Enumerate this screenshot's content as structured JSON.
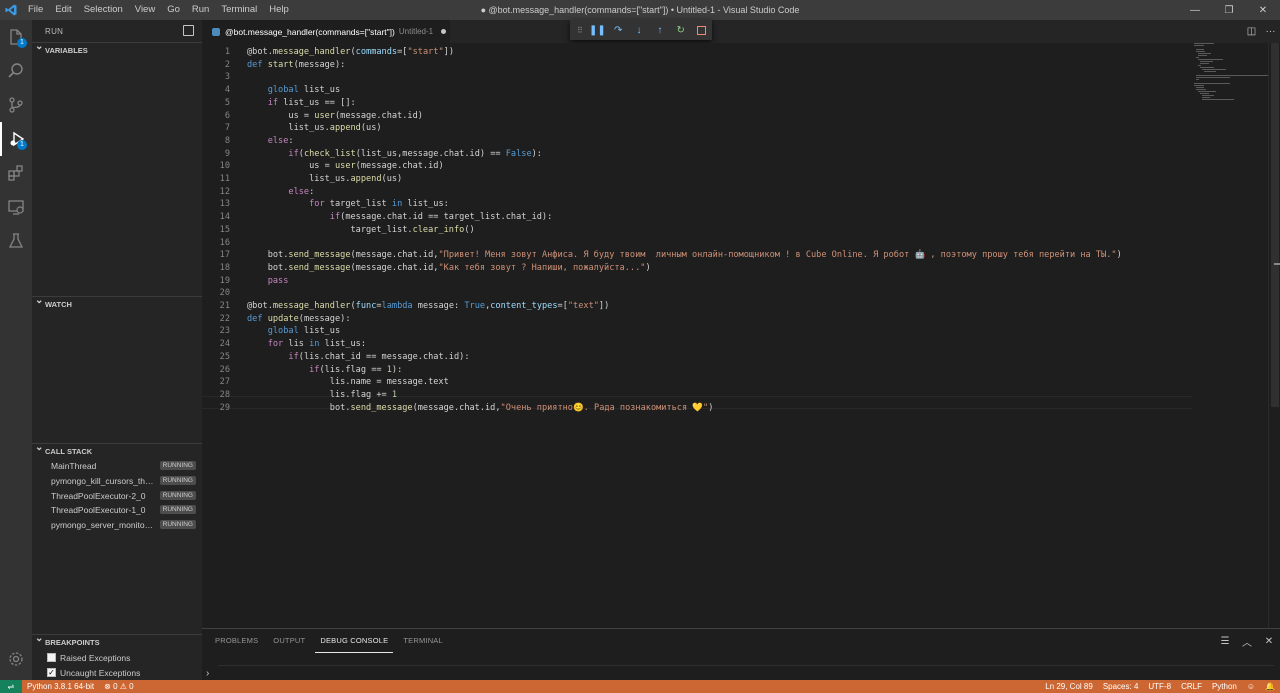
{
  "titlebar": {
    "menu": [
      "File",
      "Edit",
      "Selection",
      "View",
      "Go",
      "Run",
      "Terminal",
      "Help"
    ],
    "title": "● @bot.message_handler(commands=[\"start\"]) • Untitled-1 - Visual Studio Code"
  },
  "activitybar": {
    "items": [
      "explorer-icon",
      "search-icon",
      "source-control-icon",
      "run-debug-icon",
      "extensions-icon",
      "remote-explorer-icon",
      "testing-icon",
      "settings-gear-icon"
    ],
    "badges": {
      "explorer": "1",
      "debug": "1"
    }
  },
  "sidebar": {
    "title": "RUN",
    "sections": {
      "variables": "VARIABLES",
      "watch": "WATCH",
      "call_stack": "CALL STACK",
      "breakpoints": "BREAKPOINTS"
    },
    "threads": [
      {
        "name": "MainThread",
        "state": "RUNNING"
      },
      {
        "name": "pymongo_kill_cursors_thread",
        "state": "RUNNING"
      },
      {
        "name": "ThreadPoolExecutor-2_0",
        "state": "RUNNING"
      },
      {
        "name": "ThreadPoolExecutor-1_0",
        "state": "RUNNING"
      },
      {
        "name": "pymongo_server_monitor_thread",
        "state": "RUNNING"
      }
    ],
    "breakpoints": [
      {
        "label": "Raised Exceptions",
        "checked": false
      },
      {
        "label": "Uncaught Exceptions",
        "checked": true
      }
    ]
  },
  "editor": {
    "tab": {
      "title": "@bot.message_handler(commands=[\"start\"])",
      "subtitle": "Untitled-1"
    },
    "lines": [
      "@bot.message_handler(commands=[\"start\"])",
      "def start(message):",
      "",
      "    global list_us",
      "    if list_us == []:",
      "        us = user(message.chat.id)",
      "        list_us.append(us)",
      "    else:",
      "        if(check_list(list_us,message.chat.id) == False):",
      "            us = user(message.chat.id)",
      "            list_us.append(us)",
      "        else:",
      "            for target_list in list_us:",
      "                if(message.chat.id == target_list.chat_id):",
      "                    target_list.clear_info()",
      "",
      "    bot.send_message(message.chat.id,\"Привет! Меня зовут Анфиса. Я буду твоим  личным онлайн-помощником ! в Cube Online. Я робот 🤖 , поэтому прошу тебя перейти на ТЫ.\")",
      "    bot.send_message(message.chat.id,\"Как тебя зовут ? Напиши, пожалуйста...\")",
      "    pass",
      "",
      "@bot.message_handler(func=lambda message: True,content_types=[\"text\"])",
      "def update(message):",
      "    global list_us",
      "    for lis in list_us:",
      "        if(lis.chat_id == message.chat.id):",
      "            if(lis.flag == 1):",
      "                lis.name = message.text",
      "                lis.flag += 1",
      "                bot.send_message(message.chat.id,\"Очень приятно😊. Рада познакомиться 💛\")"
    ]
  },
  "panel": {
    "tabs": [
      "PROBLEMS",
      "OUTPUT",
      "DEBUG CONSOLE",
      "TERMINAL"
    ],
    "active_tab": "DEBUG CONSOLE",
    "prompt": "›"
  },
  "statusbar": {
    "interpreter": "Python 3.8.1 64-bit",
    "problems": "⊗ 0 ⚠ 0",
    "position": "Ln 29, Col 89",
    "spaces": "Spaces: 4",
    "encoding": "UTF-8",
    "eol": "CRLF",
    "language": "Python"
  },
  "colors": {
    "statusbar": "#cc6633",
    "activity": "#333333",
    "sidebar": "#252526",
    "editor": "#1e1e1e",
    "accent": "#007acc"
  }
}
